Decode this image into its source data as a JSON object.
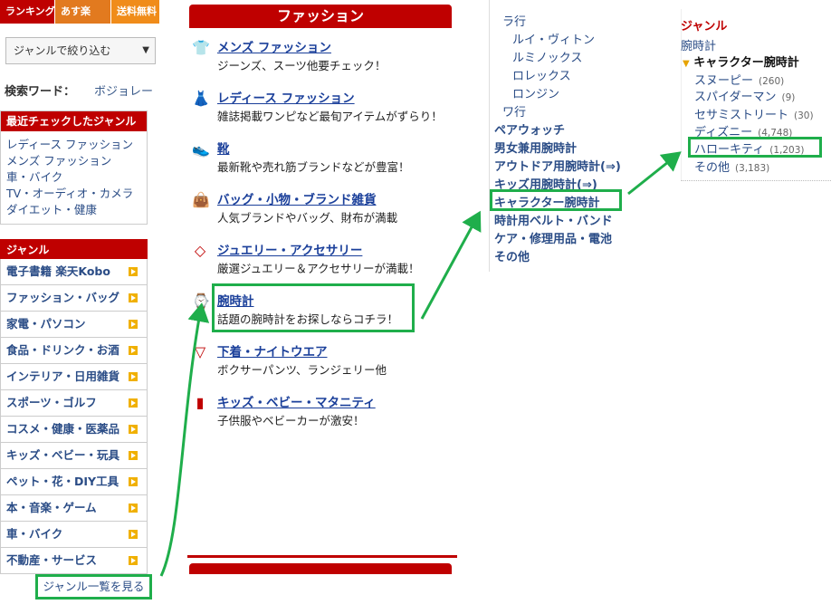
{
  "top_tabs": [
    "ランキング",
    "あす楽",
    "送料無料"
  ],
  "genre_filter": {
    "label": "ジャンルで絞り込む"
  },
  "keyword": {
    "label": "検索ワード：",
    "value": "ボジョレー"
  },
  "recent": {
    "title": "最近チェックしたジャンル",
    "items": [
      "レディース ファッション",
      "メンズ ファッション",
      "車・バイク",
      "TV・オーディオ・カメラ",
      "ダイエット・健康"
    ]
  },
  "genre": {
    "title": "ジャンル",
    "items": [
      "電子書籍 楽天Kobo",
      "ファッション・バッグ",
      "家電・パソコン",
      "食品・ドリンク・お酒",
      "インテリア・日用雑貨",
      "スポーツ・ゴルフ",
      "コスメ・健康・医薬品",
      "キッズ・ベビー・玩具",
      "ペット・花・DIY工具",
      "本・音楽・ゲーム",
      "車・バイク",
      "不動産・サービス"
    ],
    "see_all": "ジャンル一覧を見る"
  },
  "fashion": {
    "title": "ファッション",
    "categories": [
      {
        "title": "メンズ ファッション",
        "desc": "ジーンズ、スーツ他要チェック！",
        "icon": "shirt-icon"
      },
      {
        "title": "レディース ファッション",
        "desc": "雑誌掲載ワンピなど最旬アイテムがずらり！",
        "icon": "dress-icon"
      },
      {
        "title": "靴",
        "desc": "最新靴や売れ筋ブランドなどが豊富！",
        "icon": "shoe-icon"
      },
      {
        "title": "バッグ・小物・ブランド雑貨",
        "desc": "人気ブランドやバッグ、財布が満載",
        "icon": "bag-icon"
      },
      {
        "title": "ジュエリー・アクセサリー",
        "desc": "厳選ジュエリー＆アクセサリーが満載！",
        "icon": "diamond-icon"
      },
      {
        "title": "腕時計",
        "desc": "話題の腕時計をお探しならコチラ！",
        "icon": "watch-icon"
      },
      {
        "title": "下着・ナイトウエア",
        "desc": "ボクサーパンツ、ランジェリー他",
        "icon": "underwear-icon"
      },
      {
        "title": "キッズ・ベビー・マタニティ",
        "desc": "子供服やベビーカーが激安！",
        "icon": "baby-bottle-icon"
      }
    ]
  },
  "watch_sub": {
    "ra_head": "ラ行",
    "ra_items": [
      "ルイ・ヴィトン",
      "ルミノックス",
      "ロレックス",
      "ロンジン"
    ],
    "wa_head": "ワ行",
    "items": [
      "ペアウォッチ",
      "男女兼用腕時計",
      "アウトドア用腕時計(⇒)",
      "キッズ用腕時計(⇒)",
      "キャラクター腕時計",
      "時計用ベルト・バンド",
      "ケア・修理用品・電池",
      "その他"
    ]
  },
  "right_panel": {
    "head": "ジャンル",
    "parent": "腕時計",
    "current": "キャラクター腕時計",
    "children": [
      {
        "name": "スヌーピー",
        "count": "(260)"
      },
      {
        "name": "スパイダーマン",
        "count": "(9)"
      },
      {
        "name": "セサミストリート",
        "count": "(30)"
      },
      {
        "name": "ディズニー",
        "count": "(4,748)"
      },
      {
        "name": "ハローキティ",
        "count": "(1,203)"
      },
      {
        "name": "その他",
        "count": "(3,183)"
      }
    ]
  },
  "colors": {
    "brand_red": "#bf0000",
    "highlight_green": "#1fae4b",
    "link_blue": "#1a3f9a"
  }
}
